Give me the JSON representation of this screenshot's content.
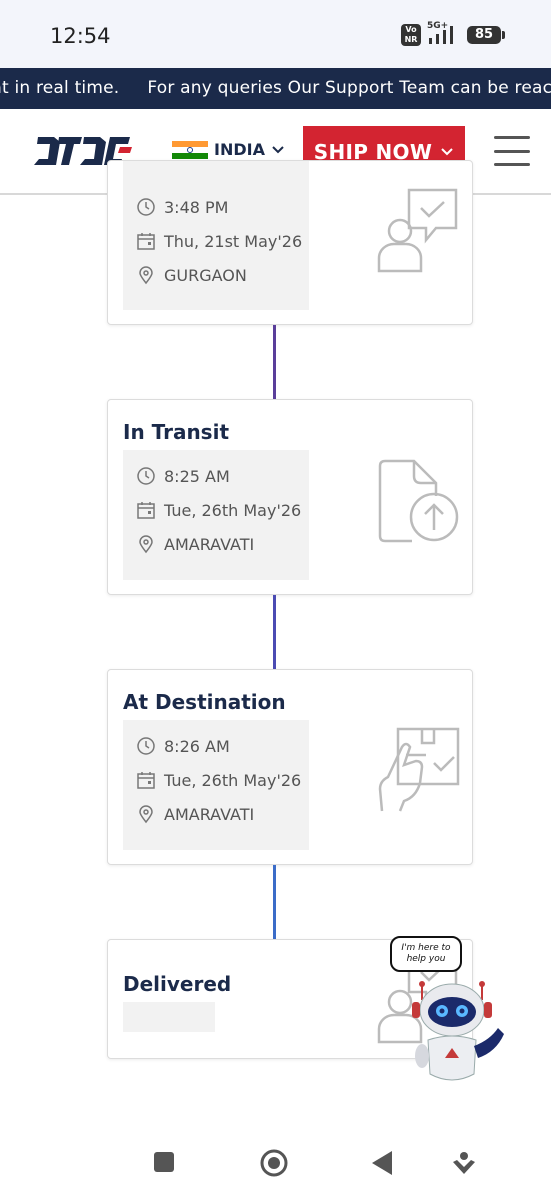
{
  "status_bar": {
    "time": "12:54",
    "volte": "Vo NR",
    "network": "5G+",
    "battery": "85"
  },
  "ticker": {
    "text": "nt in real time.     For any queries Our Support Team can be reached"
  },
  "header": {
    "logo": "DTDC",
    "country": "INDIA",
    "ship_now": "SHIP NOW",
    "flag_colors": [
      "#ff9933",
      "#ffffff",
      "#138808"
    ]
  },
  "timeline": [
    {
      "title": "",
      "time": "3:48 PM",
      "date": "Thu, 21st May'26",
      "location": "GURGAON",
      "icon": "person-chat-check-icon"
    },
    {
      "title": "In Transit",
      "time": "8:25 AM",
      "date": "Tue, 26th May'26",
      "location": "AMARAVATI",
      "icon": "document-upload-icon"
    },
    {
      "title": "At Destination",
      "time": "8:26 AM",
      "date": "Tue, 26th May'26",
      "location": "AMARAVATI",
      "icon": "hand-package-check-icon"
    },
    {
      "title": "Delivered",
      "time": "",
      "date": "",
      "location": "",
      "icon": "person-chat-check-icon"
    }
  ],
  "connector_colors": [
    "#5a3e9a",
    "#4b4bb3",
    "#3b6cc8"
  ],
  "chatbot": {
    "bubble": "I'm here to help you"
  },
  "nav": [
    "recents-icon",
    "home-icon",
    "back-icon",
    "assistant-icon"
  ],
  "colors": {
    "brand_navy": "#1b2a4a",
    "brand_red": "#d32431"
  }
}
